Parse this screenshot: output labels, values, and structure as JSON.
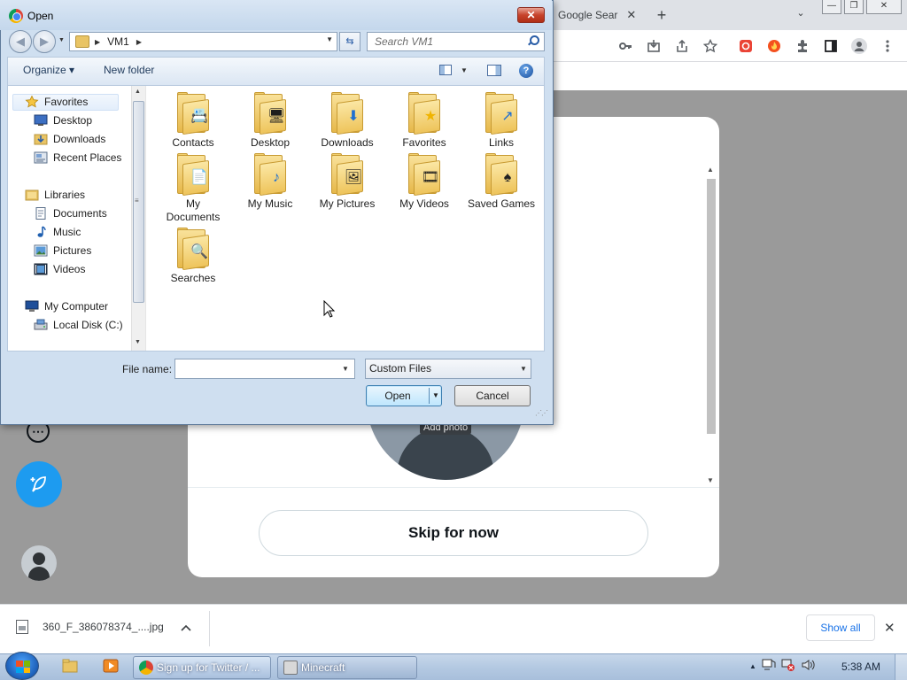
{
  "browser": {
    "tab_title": "Google Sear",
    "new_tab_symbol": "+",
    "tab_close_symbol": "✕",
    "tab_search_symbol": "⌄",
    "window_controls": [
      "—",
      "❐",
      "✕"
    ]
  },
  "twitter_modal": {
    "add_photo_label": "Add photo",
    "skip_button_label": "Skip for now",
    "more_icon_symbol": "⋯",
    "tweet_icon_symbol": "✎"
  },
  "download_bar": {
    "file_name": "360_F_386078374_....jpg",
    "chevron_symbol": "^",
    "show_all_label": "Show all",
    "close_symbol": "✕"
  },
  "dialog": {
    "title": "Open",
    "close_symbol": "✕",
    "address": {
      "segments": [
        "VM1"
      ]
    },
    "search_placeholder": "Search VM1",
    "commands": {
      "organize_label": "Organize ▾",
      "new_folder_label": "New folder",
      "help_symbol": "?"
    },
    "nav_pane": {
      "favorites_label": "Favorites",
      "favorites_items": [
        "Desktop",
        "Downloads",
        "Recent Places"
      ],
      "libraries_label": "Libraries",
      "libraries_items": [
        "Documents",
        "Music",
        "Pictures",
        "Videos"
      ],
      "computer_label": "My Computer",
      "computer_items": [
        "Local Disk (C:)"
      ]
    },
    "files": [
      {
        "name": "Contacts",
        "badge": "📇"
      },
      {
        "name": "Desktop",
        "badge": "🖥"
      },
      {
        "name": "Downloads",
        "badge": "⬇"
      },
      {
        "name": "Favorites",
        "badge": "★"
      },
      {
        "name": "Links",
        "badge": "↗"
      },
      {
        "name": "My Documents",
        "badge": "📄"
      },
      {
        "name": "My Music",
        "badge": "♪"
      },
      {
        "name": "My Pictures",
        "badge": "🖼"
      },
      {
        "name": "My Videos",
        "badge": "🎞"
      },
      {
        "name": "Saved Games",
        "badge": "♠"
      },
      {
        "name": "Searches",
        "badge": "🔍"
      }
    ],
    "file_name_label": "File name:",
    "file_name_value": "",
    "filter_value": "Custom Files",
    "open_button_label": "Open",
    "cancel_button_label": "Cancel"
  },
  "taskbar": {
    "tasks": [
      {
        "label": "Sign up for Twitter / ..."
      },
      {
        "label": "Minecraft"
      }
    ],
    "clock": "5:38 AM",
    "tray_up_symbol": "▲"
  },
  "colors": {
    "twitter_blue": "#1d9bf0",
    "dialog_frame": "#cfdff0",
    "overlay_gray": "#9a9a9a"
  }
}
